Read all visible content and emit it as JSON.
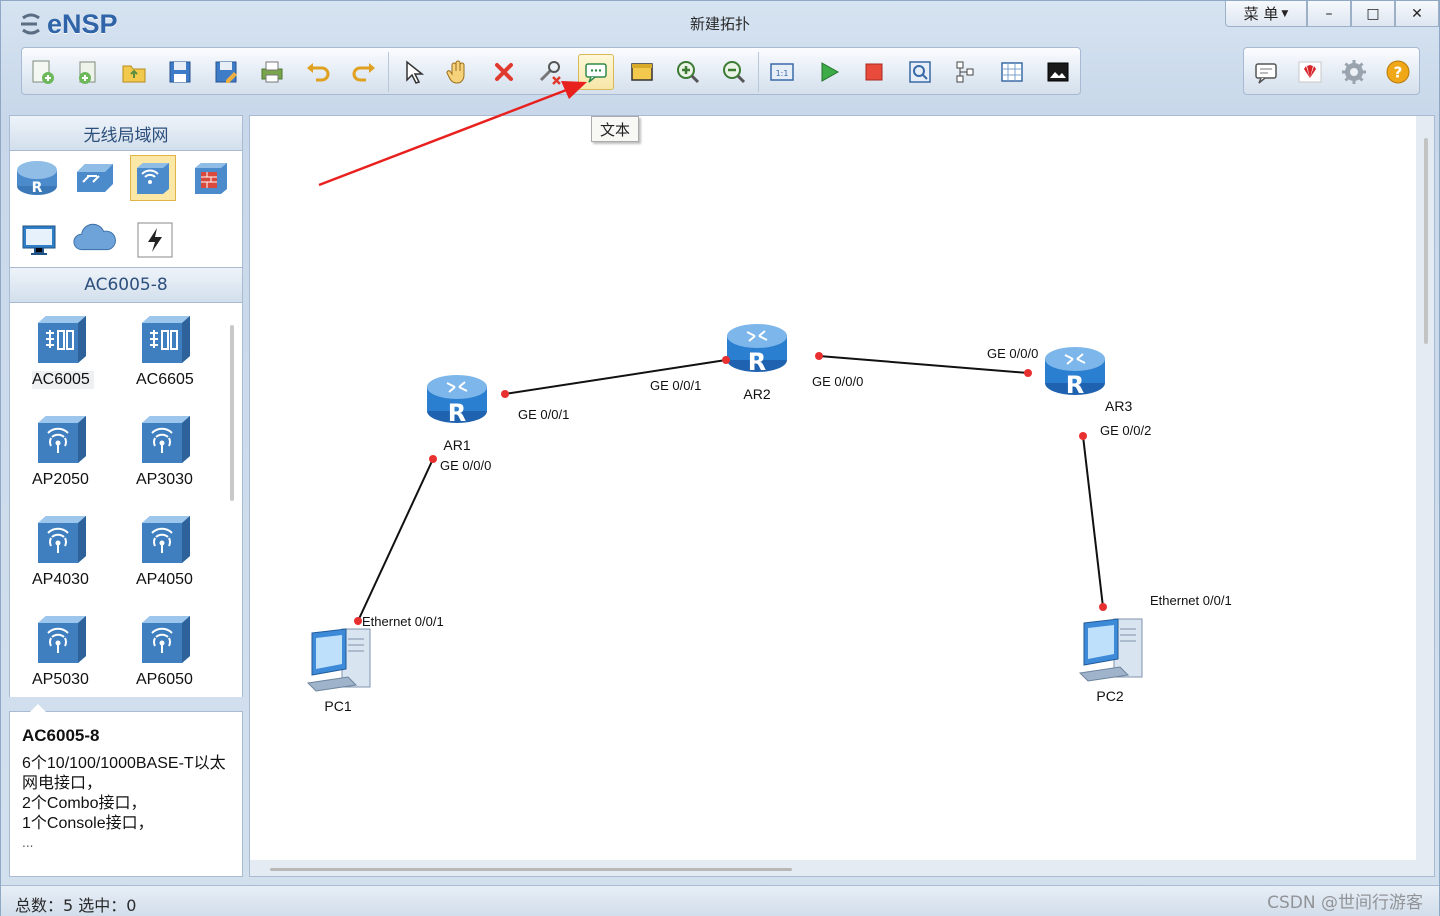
{
  "app": {
    "logo_text": "eNSP",
    "window_title": "新建拓扑"
  },
  "window_controls": {
    "menu_label": "菜 单",
    "minimize": "–",
    "maximize": "□",
    "close": "✕"
  },
  "toolbar": {
    "buttons": [
      "new-topology",
      "new-example",
      "open",
      "save",
      "save-as",
      "print",
      "undo",
      "redo",
      "select",
      "pan",
      "delete",
      "delete-link",
      "text",
      "palette",
      "zoom-in",
      "zoom-out",
      "fit",
      "start",
      "stop",
      "capture",
      "layout",
      "grid",
      "screenshot"
    ],
    "right_buttons": [
      "message",
      "huawei",
      "settings",
      "help"
    ],
    "tooltip": "文本"
  },
  "left_panel": {
    "category_header": "无线局域网",
    "categories": [
      "router",
      "switch",
      "wlan",
      "firewall",
      "terminal",
      "cloud",
      "other"
    ],
    "device_header": "AC6005-8",
    "devices": [
      "AC6005",
      "AC6605",
      "AP2050",
      "AP3030",
      "AP4030",
      "AP4050",
      "AP5030",
      "AP6050"
    ],
    "description": {
      "title": "AC6005-8",
      "lines": [
        "6个10/100/1000BASE-T以太网电接口，",
        "2个Combo接口，",
        "1个Console接口，"
      ],
      "more": "..."
    }
  },
  "topology": {
    "nodes": [
      {
        "name": "AR1",
        "type": "router"
      },
      {
        "name": "AR2",
        "type": "router"
      },
      {
        "name": "AR3",
        "type": "router"
      },
      {
        "name": "PC1",
        "type": "pc"
      },
      {
        "name": "PC2",
        "type": "pc"
      }
    ],
    "links": [
      {
        "from": "AR1",
        "from_port": "GE 0/0/1",
        "to": "AR2",
        "to_port": "GE 0/0/1"
      },
      {
        "from": "AR2",
        "from_port": "GE 0/0/0",
        "to": "AR3",
        "to_port": "GE 0/0/0"
      },
      {
        "from": "AR1",
        "from_port": "GE 0/0/0",
        "to": "PC1",
        "to_port": "Ethernet 0/0/1"
      },
      {
        "from": "AR3",
        "from_port": "GE 0/0/2",
        "to": "PC2",
        "to_port": "Ethernet 0/0/1"
      }
    ]
  },
  "status": {
    "text": "总数：5  选中：0"
  },
  "watermark": "CSDN @世间行游客",
  "colors": {
    "accent": "#2f64a8",
    "link_dot": "#e83030",
    "arrow": "#e8201e",
    "router_blue": "#2b7fd0"
  }
}
